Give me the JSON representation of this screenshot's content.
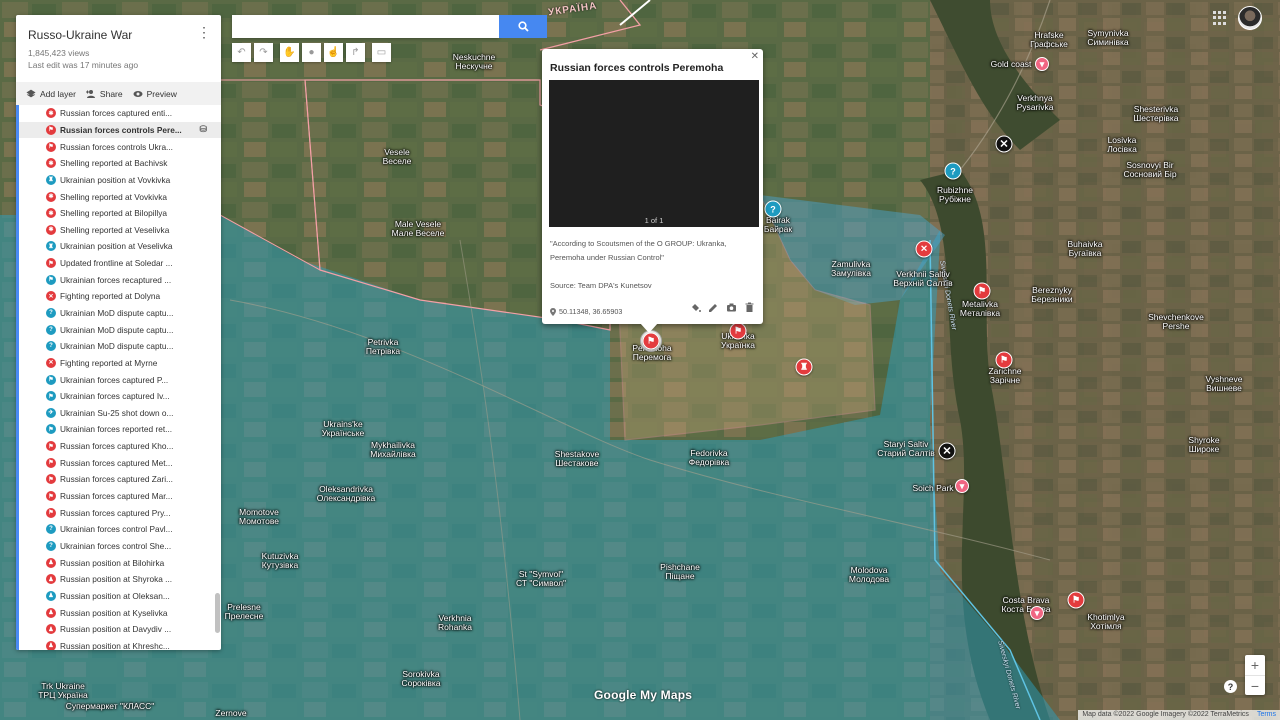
{
  "panel": {
    "title": "Russo-Ukraine War",
    "views": "1,845,423 views",
    "last_edit": "Last edit was 17 minutes ago",
    "add_layer": "Add layer",
    "share": "Share",
    "preview": "Preview"
  },
  "layer_items": [
    {
      "label": "Russian forces captured enti...",
      "color": "#e33b3e",
      "glyph": "✱"
    },
    {
      "label": "Russian forces controls Pere...",
      "color": "#e33b3e",
      "glyph": "⚑",
      "selected": true
    },
    {
      "label": "Russian forces controls Ukra...",
      "color": "#e33b3e",
      "glyph": "⚑"
    },
    {
      "label": "Shelling reported at Bachivsk",
      "color": "#e33b3e",
      "glyph": "✱"
    },
    {
      "label": "Ukrainian position at Vovkivka",
      "color": "#1e9bc0",
      "glyph": "♜"
    },
    {
      "label": "Shelling reported at Vovkivka",
      "color": "#e33b3e",
      "glyph": "✱"
    },
    {
      "label": "Shelling reported at Bilopillya",
      "color": "#e33b3e",
      "glyph": "✱"
    },
    {
      "label": "Shelling reported at Veselivka",
      "color": "#e33b3e",
      "glyph": "✱"
    },
    {
      "label": "Ukrainian position at Veselivka",
      "color": "#1e9bc0",
      "glyph": "♜"
    },
    {
      "label": "Updated frontline at Soledar ...",
      "color": "#e33b3e",
      "glyph": "⚑"
    },
    {
      "label": "Ukrainian forces recaptured ...",
      "color": "#1e9bc0",
      "glyph": "⚑"
    },
    {
      "label": "Fighting reported at Dolyna",
      "color": "#e33b3e",
      "glyph": "✕"
    },
    {
      "label": "Ukrainian MoD dispute captu...",
      "color": "#1e9bc0",
      "glyph": "?"
    },
    {
      "label": "Ukrainian MoD dispute captu...",
      "color": "#1e9bc0",
      "glyph": "?"
    },
    {
      "label": "Ukrainian MoD dispute captu...",
      "color": "#1e9bc0",
      "glyph": "?"
    },
    {
      "label": "Fighting reported at Myrne",
      "color": "#e33b3e",
      "glyph": "✕"
    },
    {
      "label": "Ukrainian forces captured P...",
      "color": "#1e9bc0",
      "glyph": "⚑"
    },
    {
      "label": "Ukrainian forces captured Iv...",
      "color": "#1e9bc0",
      "glyph": "⚑"
    },
    {
      "label": "Ukrainian Su-25 shot down o...",
      "color": "#1e9bc0",
      "glyph": "✈"
    },
    {
      "label": "Ukrainian forces reported ret...",
      "color": "#1e9bc0",
      "glyph": "⚑"
    },
    {
      "label": "Russian forces captured Kho...",
      "color": "#e33b3e",
      "glyph": "⚑"
    },
    {
      "label": "Russian forces captured Met...",
      "color": "#e33b3e",
      "glyph": "⚑"
    },
    {
      "label": "Russian forces captured Zari...",
      "color": "#e33b3e",
      "glyph": "⚑"
    },
    {
      "label": "Russian forces captured Mar...",
      "color": "#e33b3e",
      "glyph": "⚑"
    },
    {
      "label": "Russian forces captured Pry...",
      "color": "#e33b3e",
      "glyph": "⚑"
    },
    {
      "label": "Ukrainian forces control Pavl...",
      "color": "#1e9bc0",
      "glyph": "?"
    },
    {
      "label": "Ukrainian forces control She...",
      "color": "#1e9bc0",
      "glyph": "?"
    },
    {
      "label": "Russian position at Bilohirka",
      "color": "#e33b3e",
      "glyph": "♟"
    },
    {
      "label": "Russian position at Shyroka ...",
      "color": "#e33b3e",
      "glyph": "♟"
    },
    {
      "label": "Russian position at Oleksan...",
      "color": "#1e9bc0",
      "glyph": "♟"
    },
    {
      "label": "Russian position at Kyselivka",
      "color": "#e33b3e",
      "glyph": "♟"
    },
    {
      "label": "Russian position at Davydiv ...",
      "color": "#e33b3e",
      "glyph": "♟"
    },
    {
      "label": "Russian position at Khreshc...",
      "color": "#e33b3e",
      "glyph": "♟"
    }
  ],
  "search": {
    "placeholder": "",
    "value": ""
  },
  "info_window": {
    "title": "Russian forces controls Peremoha",
    "counter": "1 of 1",
    "description_1": "\"According to Scoutsmen of the O GROUP: Ukranka, Peremoha under Russian Control\"",
    "description_2": "Source: Team DPA's Kunetsov",
    "coords": "50.11348, 36.65903"
  },
  "places": [
    {
      "id": "neskuchne",
      "n1": "Neskuchne",
      "n2": "Нескучне"
    },
    {
      "id": "vesele",
      "n1": "Vesele",
      "n2": "Веселе"
    },
    {
      "id": "male-vesele",
      "n1": "Male Vesele",
      "n2": "Мале Веселе"
    },
    {
      "id": "bairak",
      "n1": "Bairak",
      "n2": "Байрак"
    },
    {
      "id": "rubizhne",
      "n1": "Rubizhne",
      "n2": "Рубіжне"
    },
    {
      "id": "zamulivka",
      "n1": "Zamulivka",
      "n2": "Замулівка"
    },
    {
      "id": "verkhnii-saltiv",
      "n1": "Verkhnii Saltiv",
      "n2": "Верхній Салтів"
    },
    {
      "id": "metalivka",
      "n1": "Metalivka",
      "n2": "Металівка"
    },
    {
      "id": "petrivka",
      "n1": "Petrivka",
      "n2": "Петрівка"
    },
    {
      "id": "peremoha",
      "n1": "Peremoha",
      "n2": "Перемога"
    },
    {
      "id": "ukrainka",
      "n1": "Ukrainka",
      "n2": "Українка"
    },
    {
      "id": "ukrainske",
      "n1": "Ukrains'ke",
      "n2": "Українське"
    },
    {
      "id": "mykhailivka",
      "n1": "Mykhailivka",
      "n2": "Михайлівка"
    },
    {
      "id": "shestakove",
      "n1": "Shestakove",
      "n2": "Шестакове"
    },
    {
      "id": "fedorivka",
      "n1": "Fedorivka",
      "n2": "Федорівка"
    },
    {
      "id": "staryi-saltiv",
      "n1": "Staryi Saltiv",
      "n2": "Старий Салтів"
    },
    {
      "id": "oleksandrivka",
      "n1": "Oleksandrivka",
      "n2": "Олександрівка"
    },
    {
      "id": "momotove",
      "n1": "Momotove",
      "n2": "Момотове"
    },
    {
      "id": "kutuzivka",
      "n1": "Kutuzivka",
      "n2": "Кутузівка"
    },
    {
      "id": "st-symvol",
      "n1": "St \"Symvol\"",
      "n2": "СТ \"Символ\""
    },
    {
      "id": "pishchane",
      "n1": "Pishchane",
      "n2": "Піщане"
    },
    {
      "id": "molodova",
      "n1": "Molodova",
      "n2": "Молодова"
    },
    {
      "id": "prelesne",
      "n1": "Prelesne",
      "n2": "Прелесне"
    },
    {
      "id": "verkhnia-rohanka",
      "n1": "Verkhnia",
      "n2": "Rohanka"
    },
    {
      "id": "sorokivka",
      "n1": "Sorokivka",
      "n2": "Сороківка"
    },
    {
      "id": "symonivka",
      "n1": "Symynivka",
      "n2": "Симинівка"
    },
    {
      "id": "hrafske",
      "n1": "Hrafske",
      "n2": "Графське"
    },
    {
      "id": "verkhnya-pysarivka",
      "n1": "Verkhnya",
      "n2": "Pysarivka"
    },
    {
      "id": "shesterivka",
      "n1": "Shesterivka",
      "n2": "Шестерівка"
    },
    {
      "id": "losivka",
      "n1": "Losivka",
      "n2": "Лосівка"
    },
    {
      "id": "sosnovyi-bir",
      "n1": "Sosnovyi Bir",
      "n2": "Сосновий Бір"
    },
    {
      "id": "buhaivka",
      "n1": "Buhaivka",
      "n2": "Бугаївка"
    },
    {
      "id": "berezhnyky",
      "n1": "Bereznyky",
      "n2": "Березники"
    },
    {
      "id": "shevchenkove",
      "n1": "Shevchenkove",
      "n2": "Pershe"
    },
    {
      "id": "zarichne",
      "n1": "Zarichne",
      "n2": "Зарічне"
    },
    {
      "id": "vyshneve",
      "n1": "Vyshneve",
      "n2": "Вишневе"
    },
    {
      "id": "shyroke",
      "n1": "Shyroke",
      "n2": "Широке"
    },
    {
      "id": "soich-park",
      "n1": "Soich Park",
      "n2": ""
    },
    {
      "id": "costa-brava",
      "n1": "Costa Brava",
      "n2": "Коста Брава"
    },
    {
      "id": "khotimlya",
      "n1": "Khotimlya",
      "n2": "Хотімля"
    },
    {
      "id": "gold-coast",
      "n1": "Gold coast",
      "n2": ""
    },
    {
      "id": "trk-ukraine",
      "n1": "Trk Ukraine",
      "n2": "ТРЦ Україна"
    },
    {
      "id": "supermarket",
      "n1": "Супермаркет \"КЛАСС\"",
      "n2": ""
    },
    {
      "id": "zernove",
      "n1": "Zernove",
      "n2": ""
    }
  ],
  "map_labels": {
    "country": "УКРАЇНА",
    "river1": "Siverskyi Donets River",
    "river2": "Siverskyi Donets River"
  },
  "logo": "Google My Maps",
  "attribution": {
    "data": "Map data ©2022 Google Imagery ©2022 TerraMetrics",
    "terms": "Terms"
  },
  "zoom": {
    "in": "+",
    "out": "−"
  },
  "help": "?",
  "colors": {
    "russian": "#e33b3e",
    "ukrainian": "#1e9bc0",
    "panel_accent": "#4a8af4",
    "search_button": "#4688f1"
  }
}
